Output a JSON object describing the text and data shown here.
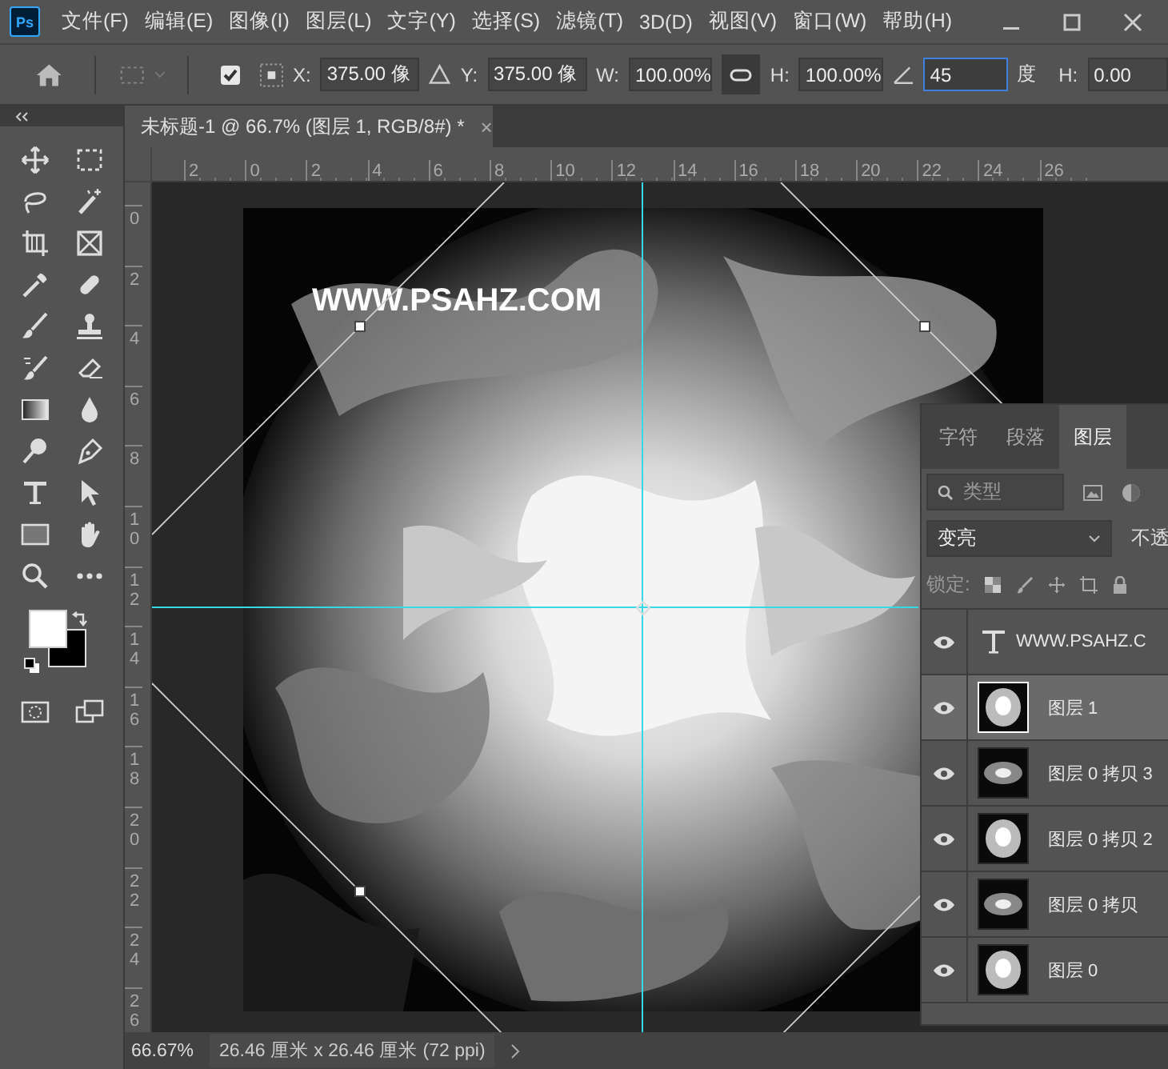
{
  "app_logo": "Ps",
  "menu": [
    "文件(F)",
    "编辑(E)",
    "图像(I)",
    "图层(L)",
    "文字(Y)",
    "选择(S)",
    "滤镜(T)",
    "3D(D)",
    "视图(V)",
    "窗口(W)",
    "帮助(H)"
  ],
  "options_bar": {
    "reference_point_checked": true,
    "x_label": "X:",
    "x_value": "375.00 像",
    "y_label": "Y:",
    "y_value": "375.00 像",
    "w_label": "W:",
    "w_value": "100.00%",
    "link_on": true,
    "h_label": "H:",
    "h_value": "100.00%",
    "angle_value": "45",
    "angle_unit": "度",
    "skew_label": "H:",
    "skew_value": "0.00"
  },
  "document_tab": {
    "title": "未标题-1 @ 66.7% (图层 1, RGB/8#) *",
    "close": "×"
  },
  "rulers": {
    "horizontal": [
      "2",
      "0",
      "2",
      "4",
      "6",
      "8",
      "10",
      "12",
      "14",
      "16",
      "18",
      "20",
      "22",
      "24",
      "26"
    ],
    "vertical": [
      "0",
      "2",
      "4",
      "6",
      "8",
      "10",
      "12",
      "14",
      "16",
      "18",
      "20",
      "22",
      "24",
      "26"
    ]
  },
  "canvas": {
    "text_layer": "WWW.PSAHZ.COM"
  },
  "layers_panel": {
    "tabs": [
      {
        "label": "字符",
        "selected": false
      },
      {
        "label": "段落",
        "selected": false
      },
      {
        "label": "图层",
        "selected": true
      }
    ],
    "filter": "类型",
    "blend_mode": "变亮",
    "opacity_label": "不透",
    "lock_label": "锁定:",
    "layers": [
      {
        "kind": "text",
        "name": "WWW.PSAHZ.C",
        "visible": true,
        "selected": false
      },
      {
        "kind": "pixel",
        "name": "图层 1",
        "visible": true,
        "selected": true
      },
      {
        "kind": "pixel",
        "name": "图层 0 拷贝 3",
        "visible": true,
        "selected": false
      },
      {
        "kind": "pixel",
        "name": "图层 0 拷贝 2",
        "visible": true,
        "selected": false
      },
      {
        "kind": "pixel",
        "name": "图层 0 拷贝",
        "visible": true,
        "selected": false
      },
      {
        "kind": "pixel",
        "name": "图层 0",
        "visible": true,
        "selected": false
      }
    ]
  },
  "status_bar": {
    "zoom": "66.67%",
    "document_info": "26.46 厘米 x 26.46 厘米 (72 ppi)"
  }
}
